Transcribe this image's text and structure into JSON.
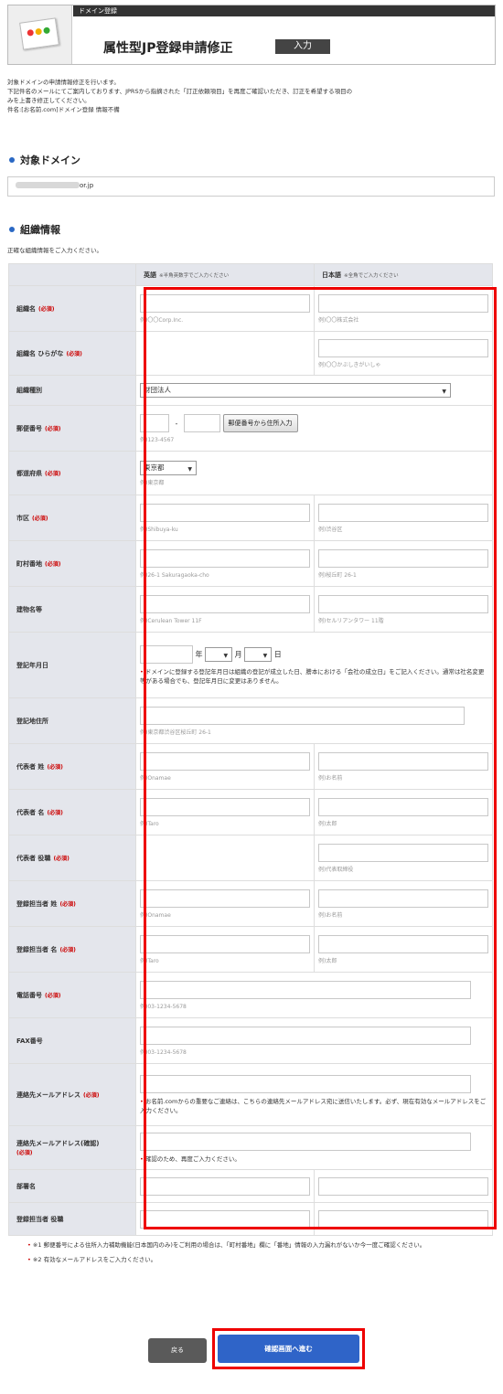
{
  "header": {
    "topbar": "ドメイン登録",
    "title": "属性型JP登録申請修正",
    "badge": "入力"
  },
  "intro": {
    "line1": "対象ドメインの申請情報修正を行います。",
    "line2": "下記件名のメールにてご案内しております、JPRSから指摘された「訂正依頼項目」を再度ご確認いただき、訂正を希望する項目の",
    "line3": "みを上書き修正してください。",
    "line4": "件名:[お名前.com]ドメイン登録 情報不備"
  },
  "domain_section": {
    "heading": "対象ドメイン",
    "domain_suffix": "or.jp"
  },
  "org_section": {
    "heading": "組織情報",
    "note": "正確な組織情報をご入力ください。",
    "col_en": "英語",
    "col_en_sub": "※半角英数字でご入力ください",
    "col_jp": "日本語",
    "col_jp_sub": "※全角でご入力ください"
  },
  "required_label": "(必須)",
  "rows": {
    "org_name": {
      "label": "組織名",
      "en_ph": "例)〇〇Corp.Inc.",
      "jp_ph": "例)〇〇株式会社"
    },
    "org_kana": {
      "label": "組織名 ひらがな",
      "jp_ph": "例)〇〇かぶしきがいしゃ"
    },
    "org_type": {
      "label": "組織種別",
      "value": "財団法人"
    },
    "zip": {
      "label": "郵便番号",
      "dash": "-",
      "button": "郵便番号から住所入力",
      "ph": "例)123-4567"
    },
    "pref": {
      "label": "都道府県",
      "value": "東京都",
      "ph": "例)東京都"
    },
    "city": {
      "label": "市区",
      "en_ph": "例)Shibuya-ku",
      "jp_ph": "例)渋谷区"
    },
    "town": {
      "label": "町村番地",
      "en_ph": "例)26-1 Sakuragaoka-cho",
      "jp_ph": "例)桜丘町 26-1"
    },
    "building": {
      "label": "建物名等",
      "en_ph": "例)Cerulean Tower 11F",
      "jp_ph": "例)セルリアンタワー 11階"
    },
    "reg_date": {
      "label": "登記年月日",
      "year": "年",
      "month": "月",
      "day": "日",
      "note": "ドメインに登録する登記年月日は組織の登記が成立した日、謄本における「会社の成立日」をご記入ください。通常は社名変更等がある場合でも、登記年月日に変更はありません。"
    },
    "reg_addr": {
      "label": "登記地住所",
      "ph": "例)東京都渋谷区桜丘町 26-1"
    },
    "rep_last": {
      "label": "代表者 姓",
      "en_ph": "例)Onamae",
      "jp_ph": "例)お名前"
    },
    "rep_first": {
      "label": "代表者 名",
      "en_ph": "例)Taro",
      "jp_ph": "例)太郎"
    },
    "rep_title": {
      "label": "代表者 役職",
      "jp_ph": "例)代表取締役"
    },
    "staff_last": {
      "label": "登録担当者 姓",
      "en_ph": "例)Onamae",
      "jp_ph": "例)お名前"
    },
    "staff_first": {
      "label": "登録担当者 名",
      "en_ph": "例)Taro",
      "jp_ph": "例)太郎"
    },
    "phone": {
      "label": "電話番号",
      "ph": "例)03-1234-5678"
    },
    "fax": {
      "label": "FAX番号",
      "ph": "例)03-1234-5678"
    },
    "email": {
      "label": "連絡先メールアドレス",
      "note": "お名前.comからの重要なご連絡は、こちらの連絡先メールアドレス宛に送信いたします。必ず、現在有効なメールアドレスをご入力ください。"
    },
    "email_confirm": {
      "label": "連絡先メールアドレス(確認)",
      "note": "確認のため、再度ご入力ください。"
    },
    "dept": {
      "label": "部署名"
    },
    "staff_title": {
      "label": "登録担当者 役職"
    }
  },
  "footnotes": {
    "n1": "※1 郵便番号による住所入力補助機能(日本国内のみ)をご利用の場合は、「町村番地」欄に「番地」情報の入力漏れがないか今一度ご確認ください。",
    "n2": "※2 有効なメールアドレスをご入力ください。"
  },
  "buttons": {
    "back": "戻る",
    "next": "確認画面へ進む"
  }
}
